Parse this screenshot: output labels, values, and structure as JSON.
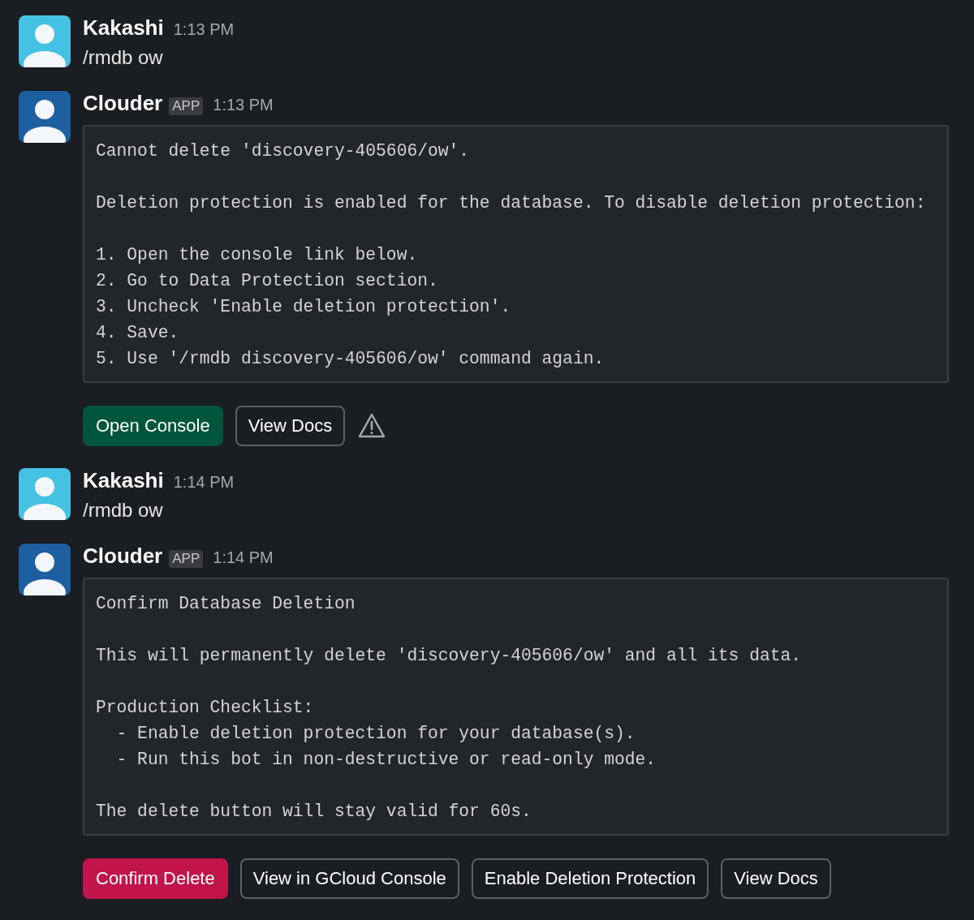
{
  "messages": [
    {
      "author": "Kakashi",
      "avatar": {
        "color": "#45c1e3"
      },
      "time": "1:13 PM",
      "text": "/rmdb ow"
    },
    {
      "author": "Clouder",
      "badge": "APP",
      "avatar": {
        "color": "#1d5fa0"
      },
      "time": "1:13 PM",
      "block": [
        [
          "Cannot delete 'discovery-405606/ow'."
        ],
        [
          "Deletion protection is enabled for the database. To disable deletion protection:"
        ],
        [
          "1. Open the console link below.",
          "2. Go to Data Protection section.",
          "3. Uncheck 'Enable deletion protection'.",
          "4. Save.",
          "5. Use '/rmdb discovery-405606/ow' command again."
        ]
      ],
      "actions": [
        {
          "label": "Open Console",
          "kind": "primary"
        },
        {
          "label": "View Docs",
          "kind": "default"
        }
      ],
      "warning": true
    },
    {
      "author": "Kakashi",
      "avatar": {
        "color": "#45c1e3"
      },
      "time": "1:14 PM",
      "text": "/rmdb ow"
    },
    {
      "author": "Clouder",
      "badge": "APP",
      "avatar": {
        "color": "#1d5fa0"
      },
      "time": "1:14 PM",
      "block": [
        [
          "Confirm Database Deletion"
        ],
        [
          "This will permanently delete 'discovery-405606/ow' and all its data."
        ],
        [
          "Production Checklist:",
          "  - Enable deletion protection for your database(s).",
          "  - Run this bot in non-destructive or read-only mode."
        ],
        [
          "The delete button will stay valid for 60s."
        ]
      ],
      "actions": [
        {
          "label": "Confirm Delete",
          "kind": "danger"
        },
        {
          "label": "View in GCloud Console",
          "kind": "default"
        },
        {
          "label": "Enable Deletion Protection",
          "kind": "default"
        },
        {
          "label": "View Docs",
          "kind": "default"
        }
      ],
      "warning": false
    }
  ]
}
